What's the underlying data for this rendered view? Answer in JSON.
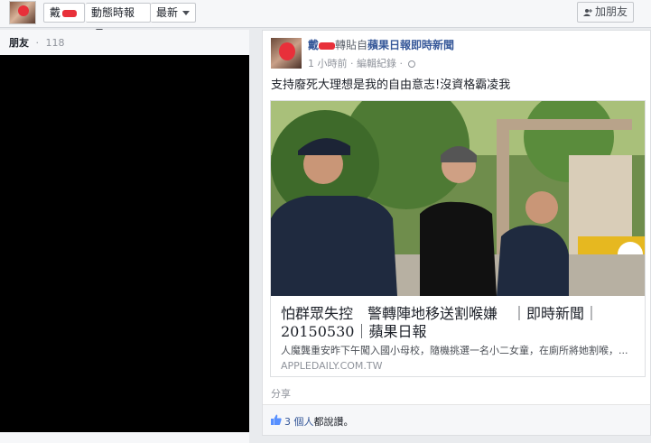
{
  "topbar": {
    "profile_name": "戴",
    "activity_label": "動態時報",
    "newest_label": "最新",
    "add_friend_label": "加朋友"
  },
  "friends": {
    "label": "朋友",
    "separator": "·",
    "count": "118"
  },
  "post": {
    "author": "戴",
    "shared_from_text": "轉貼自",
    "page_name": "蘋果日報即時新聞",
    "time": "1 小時前",
    "meta_sep": "·",
    "edit_history": "編輯紀錄",
    "message": "支持廢死大理想是我的自由意志!沒資格霸凌我",
    "link": {
      "title": "怕群眾失控　警轉陣地移送割喉嫌　｜即時新聞｜20150530｜蘋果日報",
      "description": "人魔龔重安昨下午闖入國小母校，隨機挑選一名小二女童，在廁所將她割喉，...",
      "domain": "APPLEDAILY.COM.TW"
    },
    "share_label": "分享",
    "likes_count": "3 個人",
    "likes_suffix": "都說讚。"
  },
  "colors": {
    "link_blue": "#365899",
    "bg": "#e9ebee",
    "redaction": "#e8303a"
  },
  "icons": [
    "thumbs-up-icon",
    "globe-icon",
    "caret-down-icon",
    "add-friend-icon"
  ]
}
